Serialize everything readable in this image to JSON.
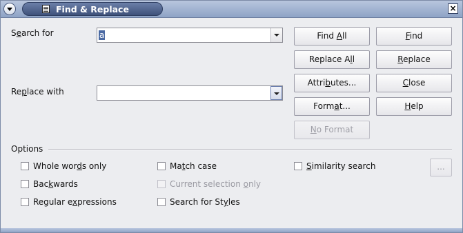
{
  "window": {
    "title": "Find & Replace",
    "close_glyph": "×"
  },
  "search": {
    "label_pre": "S",
    "label_key": "e",
    "label_post": "arch for",
    "value": "a",
    "placeholder": ""
  },
  "replace": {
    "label_pre": "Re",
    "label_key": "p",
    "label_post": "lace with",
    "value": ""
  },
  "buttons": {
    "find_all": {
      "pre": "Find ",
      "key": "A",
      "post": "ll"
    },
    "find": {
      "pre": "",
      "key": "F",
      "post": "ind"
    },
    "replace_all": {
      "pre": "Replace A",
      "key": "l",
      "post": "l"
    },
    "replace": {
      "pre": "",
      "key": "R",
      "post": "eplace"
    },
    "attributes": {
      "pre": "Attri",
      "key": "b",
      "post": "utes..."
    },
    "close": {
      "pre": "",
      "key": "C",
      "post": "lose"
    },
    "format": {
      "pre": "Form",
      "key": "a",
      "post": "t..."
    },
    "help": {
      "pre": "",
      "key": "H",
      "post": "elp"
    },
    "no_format": {
      "pre": "",
      "key": "N",
      "post": "o Format"
    },
    "more": "..."
  },
  "options": {
    "heading": "Options",
    "whole_words": {
      "pre": "Whole wor",
      "key": "d",
      "post": "s only",
      "checked": false
    },
    "match_case": {
      "pre": "Ma",
      "key": "t",
      "post": "ch case",
      "checked": false
    },
    "similarity": {
      "pre": "",
      "key": "S",
      "post": "imilarity search",
      "checked": false
    },
    "backwards": {
      "pre": "Bac",
      "key": "k",
      "post": "wards",
      "checked": false
    },
    "current_selection": {
      "pre": "Current selection ",
      "key": "o",
      "post": "nly",
      "checked": false
    },
    "regex": {
      "pre": "Regular e",
      "key": "x",
      "post": "pressions",
      "checked": false
    },
    "styles": {
      "pre": "Search for St",
      "key": "y",
      "post": "les",
      "checked": false
    }
  }
}
